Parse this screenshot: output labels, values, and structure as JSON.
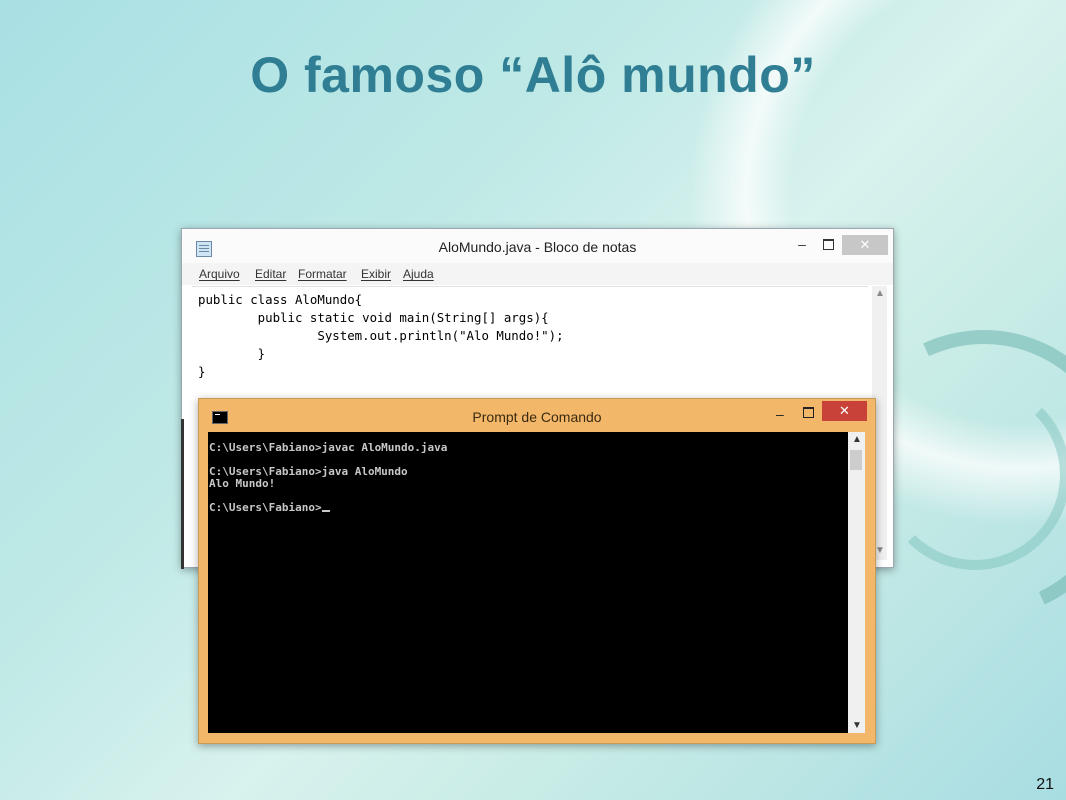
{
  "slide": {
    "title": "O famoso “Alô mundo”",
    "page_number": "21"
  },
  "notepad": {
    "window_title": "AloMundo.java - Bloco de notas",
    "menu": [
      "Arquivo",
      "Editar",
      "Formatar",
      "Exibir",
      "Ajuda"
    ],
    "content": "public class AloMundo{\n        public static void main(String[] args){\n                System.out.println(\"Alo Mundo!\");\n        }\n}",
    "close_glyph": "✕",
    "minimize_glyph": "‒"
  },
  "cmd": {
    "window_title": "Prompt de Comando",
    "output": "C:\\Users\\Fabiano>javac AloMundo.java\n\nC:\\Users\\Fabiano>java AloMundo\nAlo Mundo!\n\nC:\\Users\\Fabiano>",
    "close_glyph": "✕",
    "minimize_glyph": "‒"
  },
  "colors": {
    "title": "#2f7e93",
    "cmd_frame": "#f3b76a",
    "cmd_close": "#c9423a"
  }
}
